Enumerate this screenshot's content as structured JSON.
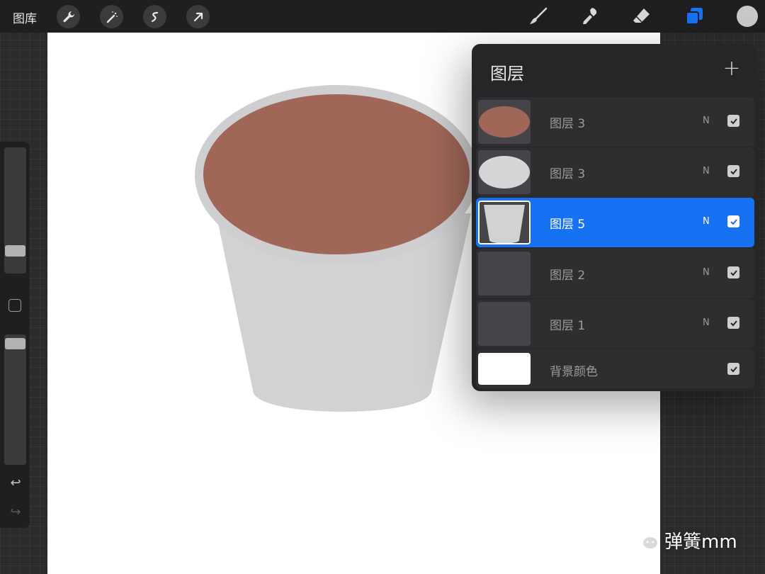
{
  "toolbar": {
    "gallery_label": "图库",
    "left_tools": [
      "wrench-icon",
      "magic-wand-icon",
      "selection-icon",
      "transform-arrow-icon"
    ],
    "right_tools": [
      "brush-icon",
      "smudge-icon",
      "eraser-icon",
      "layers-icon"
    ],
    "active_tool": "layers-icon",
    "current_color": "#c8c8c8"
  },
  "sidebar": {
    "brush_size": 0.27,
    "opacity": 1.0
  },
  "layers_panel": {
    "title": "图层",
    "add_icon": "plus-icon",
    "layers": [
      {
        "name": "图层 3",
        "mode": "N",
        "visible": true,
        "thumb": "brown-ellipse"
      },
      {
        "name": "图层 3",
        "mode": "N",
        "visible": true,
        "thumb": "grey-ellipse"
      },
      {
        "name": "图层 5",
        "mode": "N",
        "visible": true,
        "thumb": "cup-body",
        "active": true
      },
      {
        "name": "图层 2",
        "mode": "N",
        "visible": true,
        "thumb": "empty"
      },
      {
        "name": "图层 1",
        "mode": "N",
        "visible": true,
        "thumb": "empty"
      },
      {
        "name": "背景颜色",
        "mode": "",
        "visible": true,
        "thumb": "white"
      }
    ]
  },
  "artwork": {
    "cup_color": "#d2d2d4",
    "rim_color": "#cfcfd1",
    "coffee_color": "#a06758"
  },
  "watermark": {
    "text": "弹簧mm"
  },
  "colors": {
    "accent": "#1672f2",
    "panel": "#262628",
    "toolbar": "#1f1f21"
  }
}
